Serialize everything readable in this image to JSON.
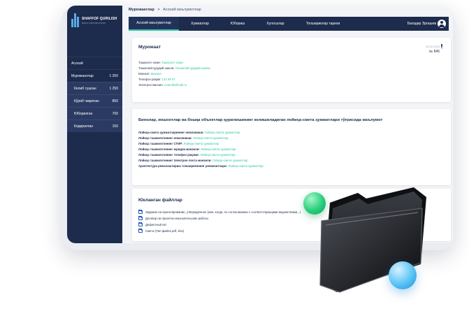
{
  "app": {
    "title": "SHAFFOF QURILISH",
    "subtitle": "BUILD CONSTRUCTION"
  },
  "sidebar": {
    "items": [
      {
        "label": "Асосий",
        "count": ""
      },
      {
        "label": "Мурожаатлар",
        "count": "1 250"
      },
      {
        "label": "Келиб тушган",
        "count": "1 250"
      },
      {
        "label": "Кўриб чиқилган",
        "count": "850"
      },
      {
        "label": "Юборилган",
        "count": "700"
      },
      {
        "label": "Кодирилган",
        "count": "150"
      }
    ]
  },
  "breadcrumb": {
    "root": "Мурожаатлар",
    "sep": ">",
    "current": "Асосий маълумотлар"
  },
  "tabs": [
    {
      "label": "Асосий маълумотлар",
      "active": true
    },
    {
      "label": "Хужжатлар",
      "active": false
    },
    {
      "label": "Юбориш",
      "active": false
    },
    {
      "label": "Хулосалар",
      "active": false
    },
    {
      "label": "Топшириклар тарихи",
      "active": false
    }
  ],
  "user": {
    "name": "Баходир Эргашев"
  },
  "card1": {
    "title": "Мурожаат",
    "date": "15.02.2023",
    "number": "№ 846",
    "rows": [
      {
        "key": "Ташкилот номи:",
        "value": "Ташкилот номи"
      },
      {
        "key": "Ташкилий-ҳуқуқий шакли:",
        "value": "Ташкилий-ҳуқуқий шакли"
      },
      {
        "key": "Манзил:",
        "value": "Манзил"
      },
      {
        "key": "Телефон рақам:",
        "value": "123 45 67"
      },
      {
        "key": "Электрон манзил:",
        "value": "exam@ellmail.ru"
      }
    ]
  },
  "card2": {
    "title": "Бинолар, иншоотлар ва бошқа объектлар қурилишининг келишиладиган лойиҳа-смета ҳужжатлари тўғрисида маълумот",
    "rows": [
      {
        "key": "Лойиҳа-смета ҳужжатларининг номланиши:",
        "value": "Лойиҳа-смета ҳужжатлар"
      },
      {
        "key": "Лойиҳа ташкилотининг номланиши:",
        "value": "Лойиҳа-смета ҳужжатлар"
      },
      {
        "key": "Лойиҳа ташкилотининг СТИР:",
        "value": "Лойиҳа-смета ҳужжатлар"
      },
      {
        "key": "Лойиҳа ташкилотининг юридик манзили:",
        "value": "Лойиҳа-смета ҳужжатлар"
      },
      {
        "key": "Лойиҳа ташкилотининг телефон рақами:",
        "value": "Лойиҳа-смета ҳужжатлар"
      },
      {
        "key": "Лойиҳа ташкилотининг Электрон почта манзили:",
        "value": "Лойиҳа-смета ҳужжатлар"
      },
      {
        "key": "Архитектура режалаштириш топшириғининг реквизитлари:",
        "value": "Лойиҳа-смета ҳужжатлар"
      }
    ]
  },
  "card3": {
    "title": "Юкланган файллар",
    "files": [
      "Задание на проектирование, утверждённое (кем, когда, по согласованию с соответствующими ведомствами...)",
      "Договор на проектно-изыскательские работы",
      "Дефектный акт",
      "Смета (Тип файла pdf, xlsx)"
    ]
  },
  "decor": {
    "folder_icon": "folder-icon",
    "orb_green": "#27cf7c",
    "orb_blue": "#58c3f5"
  }
}
